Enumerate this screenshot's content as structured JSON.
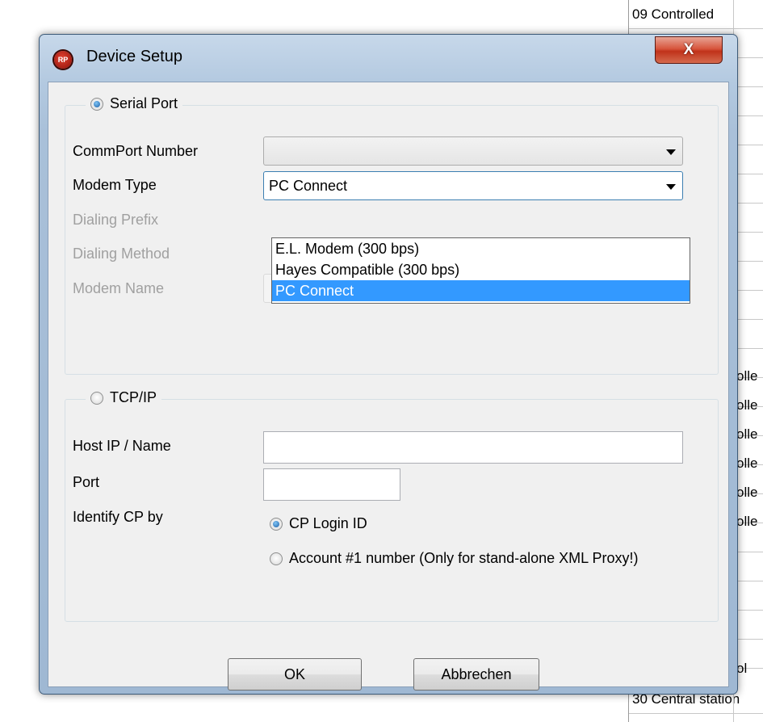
{
  "background": {
    "rows": [
      "09 Controlled",
      "",
      "",
      "",
      "",
      "",
      "",
      "",
      "",
      "",
      "",
      "",
      "",
      "",
      "",
      "",
      "",
      "",
      "",
      "",
      "",
      "",
      "",
      "30 Central station",
      ""
    ],
    "fragments": [
      "olle",
      "olle",
      "olle",
      "olle",
      "olle",
      "olle",
      "ol"
    ]
  },
  "dialog": {
    "title": "Device Setup",
    "app_icon_text": "RP",
    "close_glyph": "X",
    "serial": {
      "label": "Serial Port",
      "checked": true,
      "commport_label": "CommPort Number",
      "commport_value": "",
      "modem_type_label": "Modem Type",
      "modem_type_value": "PC Connect",
      "modem_type_options": [
        "E.L. Modem (300 bps)",
        "Hayes Compatible (300 bps)",
        "PC Connect"
      ],
      "modem_type_selected_index": 2,
      "dialing_prefix_label": "Dialing Prefix",
      "dialing_method_label": "Dialing Method",
      "modem_name_label": "Modem Name",
      "modem_name_value": ""
    },
    "tcp": {
      "label": "TCP/IP",
      "checked": false,
      "host_label": "Host IP / Name",
      "host_value": "",
      "port_label": "Port",
      "port_value": "",
      "identify_label": "Identify CP by",
      "option_login": "CP Login ID",
      "option_account": "Account #1 number (Only for stand-alone XML Proxy!)",
      "identify_selected": "CP Login ID"
    },
    "ok_label": "OK",
    "cancel_label": "Abbrechen"
  }
}
